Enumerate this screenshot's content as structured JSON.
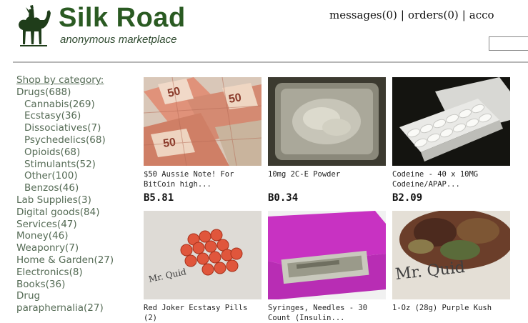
{
  "site": {
    "title": "Silk Road",
    "tagline": "anonymous marketplace"
  },
  "topnav": {
    "messages": "messages(0)",
    "orders": "orders(0)",
    "account": "acco"
  },
  "sidebar": {
    "heading": "Shop by category:",
    "categories": [
      {
        "label": "Drugs(688)",
        "level": 0
      },
      {
        "label": "Cannabis(269)",
        "level": 1
      },
      {
        "label": "Ecstasy(36)",
        "level": 1
      },
      {
        "label": "Dissociatives(7)",
        "level": 1
      },
      {
        "label": "Psychedelics(68)",
        "level": 1
      },
      {
        "label": "Opioids(68)",
        "level": 1
      },
      {
        "label": "Stimulants(52)",
        "level": 1
      },
      {
        "label": "Other(100)",
        "level": 1
      },
      {
        "label": "Benzos(46)",
        "level": 1
      },
      {
        "label": "Lab Supplies(3)",
        "level": 0
      },
      {
        "label": "Digital goods(84)",
        "level": 0
      },
      {
        "label": "Services(47)",
        "level": 0
      },
      {
        "label": "Money(46)",
        "level": 0
      },
      {
        "label": "Weaponry(7)",
        "level": 0
      },
      {
        "label": "Home & Garden(27)",
        "level": 0
      },
      {
        "label": "Electronics(8)",
        "level": 0
      },
      {
        "label": "Books(36)",
        "level": 0
      },
      {
        "label": "Drug",
        "level": 0
      },
      {
        "label": "paraphernalia(27)",
        "level": 0
      }
    ]
  },
  "products": [
    {
      "name": "$50 Aussie Note! For\nBitCoin high...",
      "price": "B5.81",
      "image": "banknotes-photo"
    },
    {
      "name": "10mg 2C-E Powder",
      "price": "B0.34",
      "image": "powder-tray-photo"
    },
    {
      "name": "Codeine - 40 x 10MG\nCodeine/APAP...",
      "price": "B2.09",
      "image": "pill-blister-photo"
    },
    {
      "name": "Red Joker Ecstasy Pills\n(2)",
      "price": "",
      "image": "red-pills-photo"
    },
    {
      "name": "Syringes, Needles - 30\nCount (Insulin...",
      "price": "",
      "image": "syringe-box-photo"
    },
    {
      "name": "1-Oz (28g) Purple Kush",
      "price": "",
      "image": "cannabis-photo"
    }
  ],
  "colors": {
    "title_green": "#2a5a22",
    "sidebar_text": "#556b55",
    "rule": "#b7b7b7"
  }
}
